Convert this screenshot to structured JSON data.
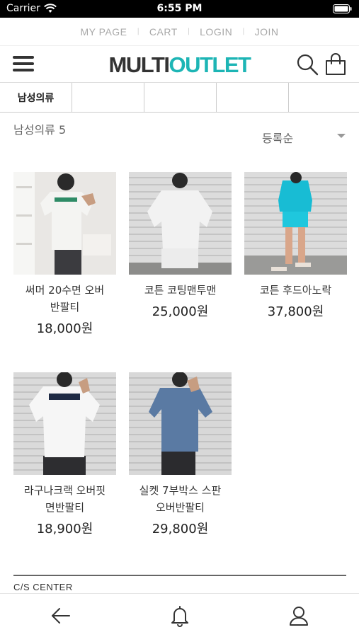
{
  "status_bar": {
    "carrier": "Carrier",
    "time": "6:55 PM"
  },
  "top_links": [
    "MY PAGE",
    "CART",
    "LOGIN",
    "JOIN"
  ],
  "logo": {
    "multi": "MULTI",
    "outlet": "OUTLET"
  },
  "category_tabs": [
    {
      "label": "남성의류",
      "active": true
    },
    {
      "label": ""
    },
    {
      "label": ""
    },
    {
      "label": ""
    },
    {
      "label": ""
    }
  ],
  "list": {
    "title": "남성의류 5",
    "sort": "등록순"
  },
  "products": [
    {
      "name": "써머 20수면 오버반팔티",
      "price": "18,000원"
    },
    {
      "name": "코튼 코팅맨투맨",
      "price": "25,000원"
    },
    {
      "name": "코튼 후드아노락",
      "price": "37,800원"
    },
    {
      "name": "라구나크랙 오버핏 면반팔티",
      "price": "18,900원"
    },
    {
      "name": "실켓 7부박스 스판 오버반팔티",
      "price": "29,800원"
    }
  ],
  "footer": {
    "cs_center": "C/S CENTER"
  },
  "icons": {
    "menu": "hamburger-icon",
    "search": "search-icon",
    "cart": "shopping-bag-icon",
    "back": "back-arrow-icon",
    "notification": "bell-icon",
    "profile": "user-icon"
  },
  "colors": {
    "accent": "#1db5b5",
    "text": "#333333"
  }
}
